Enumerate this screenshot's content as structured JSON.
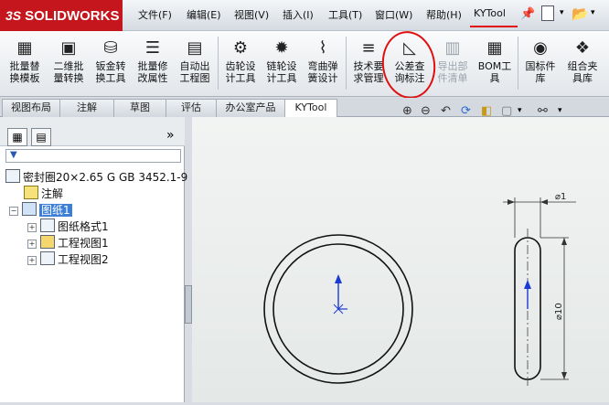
{
  "app": {
    "logo_prefix": "3S",
    "logo_text": "SOLIDWORKS"
  },
  "menu": {
    "items": [
      "文件(F)",
      "编辑(E)",
      "视图(V)",
      "插入(I)",
      "工具(T)",
      "窗口(W)",
      "帮助(H)",
      "KYTool"
    ]
  },
  "ribbon": {
    "buttons": [
      {
        "label": "批量替\n换模板",
        "icon": "template-replace-icon"
      },
      {
        "label": "二维批\n量转换",
        "icon": "2d-batch-convert-icon"
      },
      {
        "label": "钣金转\n换工具",
        "icon": "sheetmetal-convert-icon"
      },
      {
        "label": "批量修\n改属性",
        "icon": "batch-properties-icon"
      },
      {
        "label": "自动出\n工程图",
        "icon": "auto-drawing-icon"
      },
      {
        "label": "齿轮设\n计工具",
        "icon": "gear-design-icon"
      },
      {
        "label": "链轮设\n计工具",
        "icon": "sprocket-design-icon"
      },
      {
        "label": "弯曲弹\n簧设计",
        "icon": "spring-design-icon"
      },
      {
        "label": "技术要\n求管理",
        "icon": "tech-requirements-icon"
      },
      {
        "label": "公差查\n询标注",
        "icon": "tolerance-query-icon"
      },
      {
        "label": "导出部\n件清单",
        "icon": "export-bom-icon",
        "disabled": true
      },
      {
        "label": "BOM工\n具",
        "icon": "bom-tool-icon"
      },
      {
        "label": "国标件\n库",
        "icon": "standard-parts-icon"
      },
      {
        "label": "组合夹\n具库",
        "icon": "fixture-library-icon"
      }
    ]
  },
  "tabs": [
    "视图布局",
    "注解",
    "草图",
    "评估",
    "办公室产品",
    "KYTool"
  ],
  "active_tab": "KYTool",
  "tree": {
    "panel_toggle": "»",
    "root": "密封圈20×2.65 G GB 3452.1-9",
    "annotations": "注解",
    "sheet": "图纸1",
    "children": [
      "图纸格式1",
      "工程视图1",
      "工程视图2"
    ]
  },
  "drawing": {
    "dim_top": "⌀1",
    "dim_side": "⌀10"
  },
  "colors": {
    "accent": "#c4161c",
    "selection": "#3d7fd6",
    "highlight_mark": "#e01010"
  }
}
